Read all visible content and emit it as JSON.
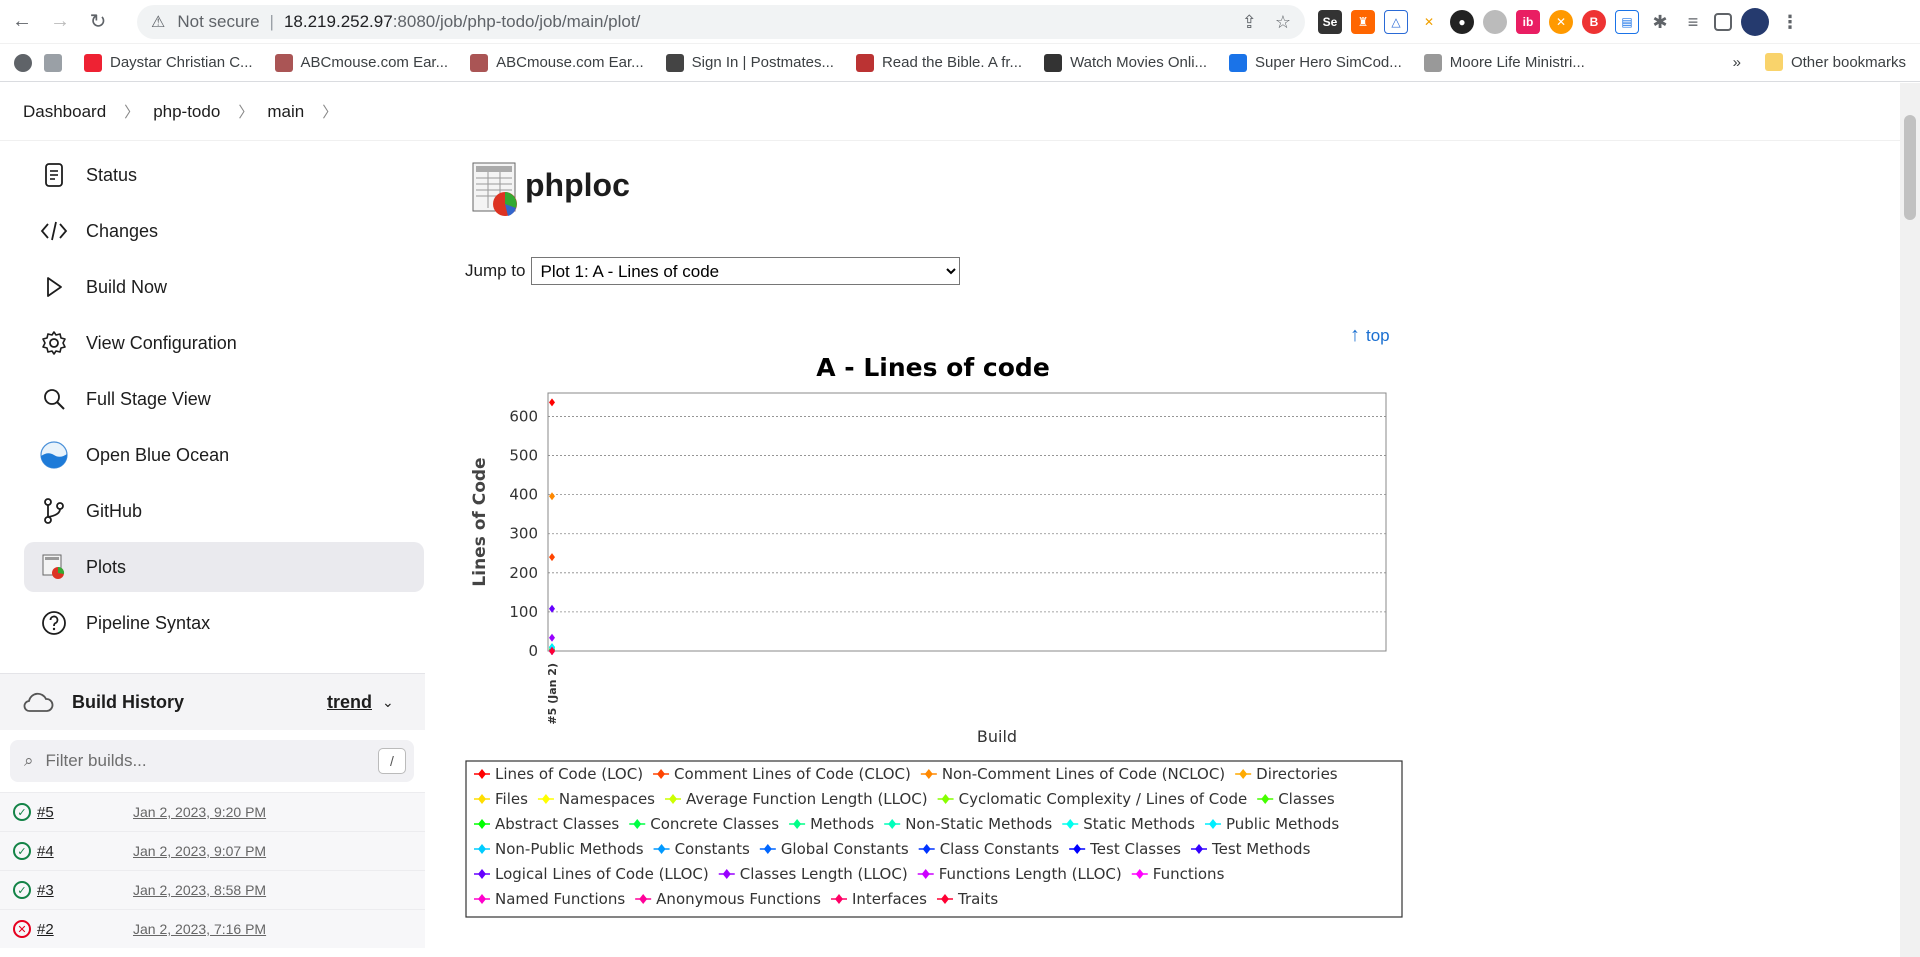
{
  "browser": {
    "security_label": "Not secure",
    "url_host": "18.219.252.97",
    "url_path": ":8080/job/php-todo/job/main/plot/",
    "bookmarks": [
      {
        "label": "Daystar Christian C...",
        "color": "#e23"
      },
      {
        "label": "ABCmouse.com Ear...",
        "color": "#a55"
      },
      {
        "label": "ABCmouse.com Ear...",
        "color": "#a55"
      },
      {
        "label": "Sign In | Postmates...",
        "color": "#444"
      },
      {
        "label": "Read the Bible. A fr...",
        "color": "#b33"
      },
      {
        "label": "Watch Movies Onli...",
        "color": "#333"
      },
      {
        "label": "Super Hero SimCod...",
        "color": "#1a73e8"
      },
      {
        "label": "Moore Life Ministri...",
        "color": "#999"
      }
    ],
    "more_bookmarks": "»",
    "other_bookmarks": "Other bookmarks"
  },
  "breadcrumb": [
    "Dashboard",
    "php-todo",
    "main"
  ],
  "sidebar": {
    "items": [
      {
        "label": "Status",
        "icon": "document-icon"
      },
      {
        "label": "Changes",
        "icon": "code-icon"
      },
      {
        "label": "Build Now",
        "icon": "play-icon"
      },
      {
        "label": "View Configuration",
        "icon": "gear-icon"
      },
      {
        "label": "Full Stage View",
        "icon": "search-icon"
      },
      {
        "label": "Open Blue Ocean",
        "icon": "blue-ocean-icon"
      },
      {
        "label": "GitHub",
        "icon": "branch-icon"
      },
      {
        "label": "Plots",
        "icon": "plot-icon"
      },
      {
        "label": "Pipeline Syntax",
        "icon": "help-icon"
      }
    ],
    "active_index": 7
  },
  "build_history": {
    "title": "Build History",
    "trend_label": "trend",
    "filter_placeholder": "Filter builds...",
    "filter_shortcut": "/",
    "builds": [
      {
        "number": "#5",
        "date": "Jan 2, 2023, 9:20 PM",
        "status": "success"
      },
      {
        "number": "#4",
        "date": "Jan 2, 2023, 9:07 PM",
        "status": "success"
      },
      {
        "number": "#3",
        "date": "Jan 2, 2023, 8:58 PM",
        "status": "success"
      },
      {
        "number": "#2",
        "date": "Jan 2, 2023, 7:16 PM",
        "status": "failed"
      }
    ]
  },
  "main": {
    "title": "phploc",
    "jump_label": "Jump to",
    "jump_selected": "Plot 1: A - Lines of code",
    "top_link": "top"
  },
  "chart_data": {
    "type": "line",
    "title": "A - Lines of code",
    "xlabel": "Build",
    "ylabel": "Lines of Code",
    "categories": [
      "#5 (Jan 2)"
    ],
    "ylim": [
      0,
      660
    ],
    "yticks": [
      0,
      100,
      200,
      300,
      400,
      500,
      600
    ],
    "grid": true,
    "legend_position": "bottom",
    "series": [
      {
        "name": "Lines of Code (LOC)",
        "color": "#ff0000",
        "values": [
          636
        ]
      },
      {
        "name": "Comment Lines of Code (CLOC)",
        "color": "#ff4400",
        "values": [
          240
        ]
      },
      {
        "name": "Non-Comment Lines of Code (NCLOC)",
        "color": "#ff8800",
        "values": [
          396
        ]
      },
      {
        "name": "Directories",
        "color": "#ffaa00",
        "values": [
          5
        ]
      },
      {
        "name": "Files",
        "color": "#ffdd00",
        "values": [
          9
        ]
      },
      {
        "name": "Namespaces",
        "color": "#ffff00",
        "values": [
          2
        ]
      },
      {
        "name": "Average Function Length (LLOC)",
        "color": "#ccff00",
        "values": [
          3
        ]
      },
      {
        "name": "Cyclomatic Complexity / Lines of Code",
        "color": "#88ff00",
        "values": [
          0
        ]
      },
      {
        "name": "Classes",
        "color": "#44ff00",
        "values": [
          4
        ]
      },
      {
        "name": "Abstract Classes",
        "color": "#00ff00",
        "values": [
          0
        ]
      },
      {
        "name": "Concrete Classes",
        "color": "#00ff44",
        "values": [
          4
        ]
      },
      {
        "name": "Methods",
        "color": "#00ff88",
        "values": [
          10
        ]
      },
      {
        "name": "Non-Static Methods",
        "color": "#00ffbb",
        "values": [
          9
        ]
      },
      {
        "name": "Static Methods",
        "color": "#00ffee",
        "values": [
          1
        ]
      },
      {
        "name": "Public Methods",
        "color": "#00eeff",
        "values": [
          10
        ]
      },
      {
        "name": "Non-Public Methods",
        "color": "#00ccff",
        "values": [
          0
        ]
      },
      {
        "name": "Constants",
        "color": "#0099ff",
        "values": [
          0
        ]
      },
      {
        "name": "Global Constants",
        "color": "#0066ff",
        "values": [
          0
        ]
      },
      {
        "name": "Class Constants",
        "color": "#0033ff",
        "values": [
          0
        ]
      },
      {
        "name": "Test Classes",
        "color": "#0000ff",
        "values": [
          0
        ]
      },
      {
        "name": "Test Methods",
        "color": "#3300ff",
        "values": [
          0
        ]
      },
      {
        "name": "Logical Lines of Code (LLOC)",
        "color": "#6600ff",
        "values": [
          108
        ]
      },
      {
        "name": "Classes Length (LLOC)",
        "color": "#9900ff",
        "values": [
          34
        ]
      },
      {
        "name": "Functions Length (LLOC)",
        "color": "#cc00ff",
        "values": [
          0
        ]
      },
      {
        "name": "Functions",
        "color": "#ff00ff",
        "values": [
          0
        ]
      },
      {
        "name": "Named Functions",
        "color": "#ff00cc",
        "values": [
          0
        ]
      },
      {
        "name": "Anonymous Functions",
        "color": "#ff0099",
        "values": [
          0
        ]
      },
      {
        "name": "Interfaces",
        "color": "#ff0066",
        "values": [
          0
        ]
      },
      {
        "name": "Traits",
        "color": "#ff0033",
        "values": [
          0
        ]
      }
    ]
  }
}
